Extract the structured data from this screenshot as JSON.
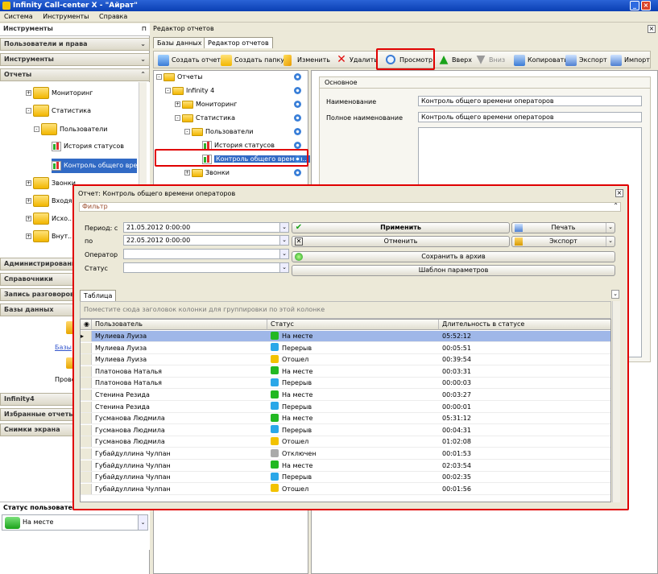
{
  "window": {
    "title": "Infinity Call-center X - \"Айрат\""
  },
  "menu": [
    "Система",
    "Инструменты",
    "Справка"
  ],
  "left": {
    "header": "Инструменты",
    "sections_top": [
      "Пользователи и права",
      "Инструменты",
      "Отчеты"
    ],
    "tree": [
      "Мониторинг",
      "Статистика",
      "Пользователи",
      "История статусов",
      "Контроль общего вре...",
      "Звонки",
      "Входя...",
      "Исхо...",
      "Внут..."
    ],
    "sections_mid": [
      "Администрирование",
      "Справочники",
      "Запись разговоров",
      "Базы данных"
    ],
    "db_items": [
      "Базы",
      "Прово"
    ],
    "sections_bottom": [
      "Infinity4",
      "Избранные отчеты",
      "Снимки экрана"
    ],
    "user_status": {
      "title": "Статус пользователя",
      "value": "На месте"
    }
  },
  "right": {
    "title": "Редактор отчетов",
    "tabs": [
      "Базы данных",
      "Редактор отчетов"
    ],
    "toolbar": [
      "Создать отчет",
      "Создать папку",
      "Изменить",
      "Удалить",
      "Просмотр",
      "Вверх",
      "Вниз",
      "Копировать",
      "Экспорт",
      "Импорт"
    ],
    "tree": [
      "Отчеты",
      "Infinity 4",
      "Мониторинг",
      "Статистика",
      "Пользователи",
      "История статусов",
      "Контроль общего времен...",
      "Звонки"
    ],
    "props": {
      "tab": "Основное",
      "name_label": "Наименование",
      "name_value": "Контроль общего времени операторов",
      "full_label": "Полное наименование",
      "full_value": "Контроль общего времени операторов"
    }
  },
  "dialog": {
    "title": "Отчет: Контроль общего времени операторов",
    "filter_title": "Фильтр",
    "period_from_label": "Период: с",
    "period_from": "21.05.2012 0:00:00",
    "period_to_label": "по",
    "period_to": "22.05.2012 0:00:00",
    "operator_label": "Оператор",
    "status_label": "Статус",
    "buttons": {
      "apply": "Применить",
      "cancel": "Отменить",
      "print": "Печать",
      "export": "Экспорт",
      "archive": "Сохранить в архив",
      "template": "Шаблон параметров"
    },
    "table_tab": "Таблица",
    "group_hint": "Поместите сюда заголовок колонки для группировки по этой колонке",
    "columns": [
      "Пользователь",
      "Статус",
      "Длительность в статусе"
    ],
    "rows": [
      {
        "user": "Мулиева Луиза",
        "status": "На месте",
        "color": "#22b822",
        "dur": "05:52:12"
      },
      {
        "user": "Мулиева Луиза",
        "status": "Перерыв",
        "color": "#2aa7e8",
        "dur": "00:05:51"
      },
      {
        "user": "Мулиева Луиза",
        "status": "Отошел",
        "color": "#f2c200",
        "dur": "00:39:54"
      },
      {
        "user": "Платонова Наталья",
        "status": "На месте",
        "color": "#22b822",
        "dur": "00:03:31"
      },
      {
        "user": "Платонова Наталья",
        "status": "Перерыв",
        "color": "#2aa7e8",
        "dur": "00:00:03"
      },
      {
        "user": "Стенина Резида",
        "status": "На месте",
        "color": "#22b822",
        "dur": "00:03:27"
      },
      {
        "user": "Стенина Резида",
        "status": "Перерыв",
        "color": "#2aa7e8",
        "dur": "00:00:01"
      },
      {
        "user": "Гусманова Людмила",
        "status": "На месте",
        "color": "#22b822",
        "dur": "05:31:12"
      },
      {
        "user": "Гусманова Людмила",
        "status": "Перерыв",
        "color": "#2aa7e8",
        "dur": "00:04:31"
      },
      {
        "user": "Гусманова Людмила",
        "status": "Отошел",
        "color": "#f2c200",
        "dur": "01:02:08"
      },
      {
        "user": "Губайдуллина Чулпан",
        "status": "Отключен",
        "color": "#aaaaaa",
        "dur": "00:01:53"
      },
      {
        "user": "Губайдуллина Чулпан",
        "status": "На месте",
        "color": "#22b822",
        "dur": "02:03:54"
      },
      {
        "user": "Губайдуллина Чулпан",
        "status": "Перерыв",
        "color": "#2aa7e8",
        "dur": "00:02:35"
      },
      {
        "user": "Губайдуллина Чулпан",
        "status": "Отошел",
        "color": "#f2c200",
        "dur": "00:01:56"
      }
    ]
  }
}
